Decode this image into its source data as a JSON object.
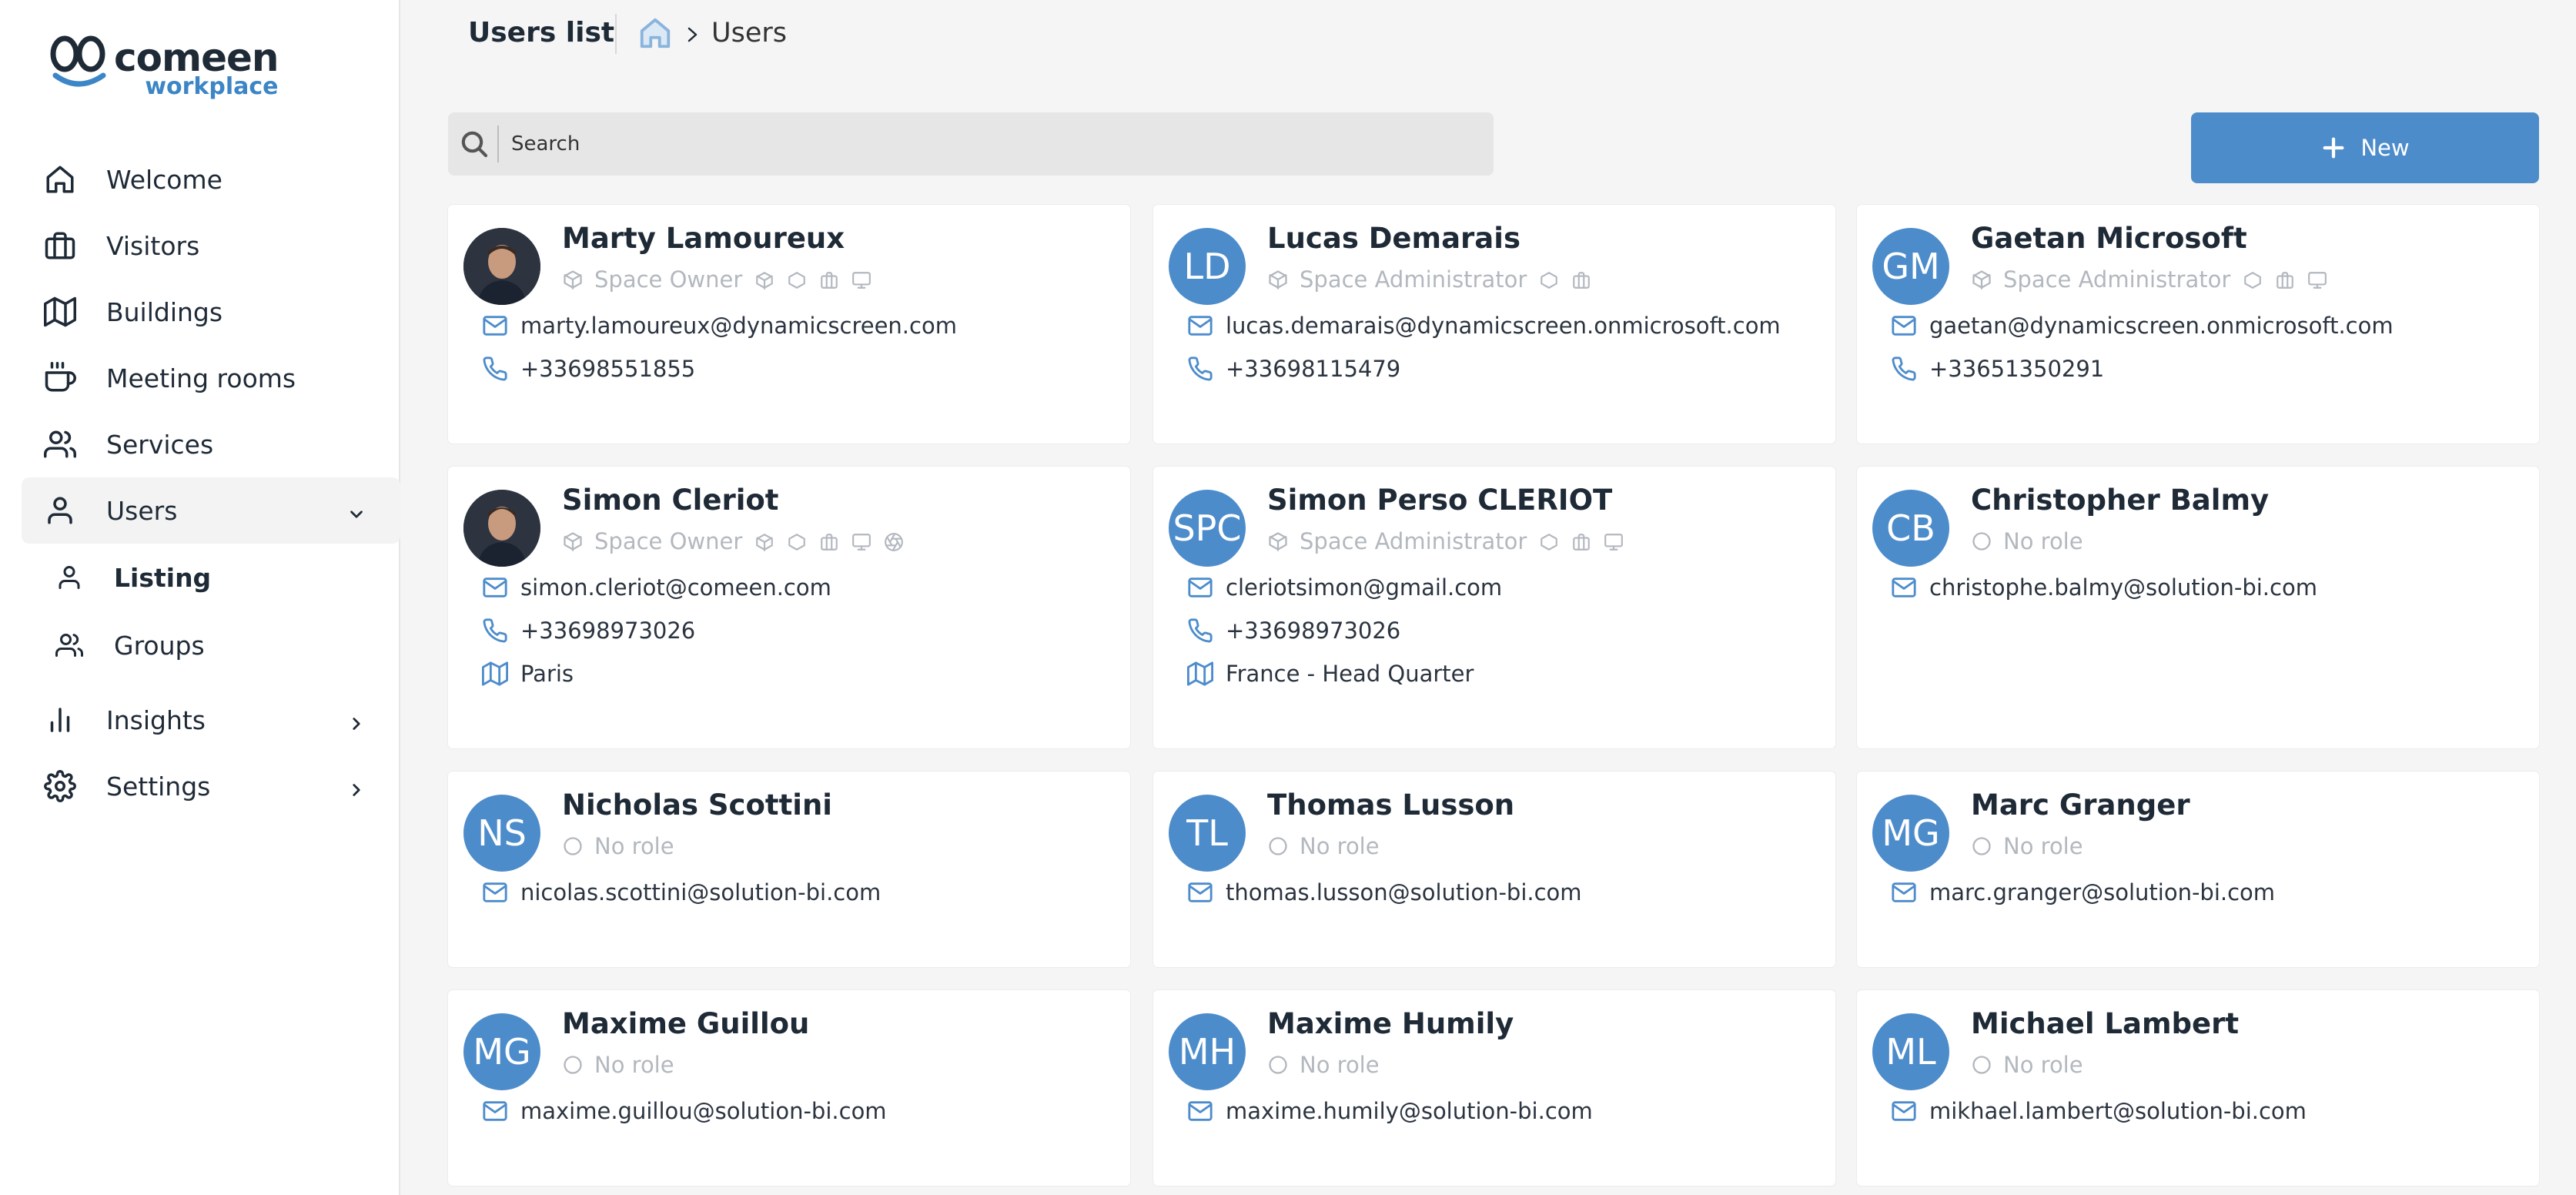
{
  "app": {
    "logo_primary": "comeen",
    "logo_secondary": "workplace"
  },
  "sidebar": {
    "items": [
      {
        "label": "Welcome",
        "icon": "home-icon"
      },
      {
        "label": "Visitors",
        "icon": "briefcase-icon"
      },
      {
        "label": "Buildings",
        "icon": "map-icon"
      },
      {
        "label": "Meeting rooms",
        "icon": "coffee-cup-icon"
      },
      {
        "label": "Services",
        "icon": "users-icon"
      },
      {
        "label": "Users",
        "icon": "user-icon",
        "expanded": true
      },
      {
        "label": "Insights",
        "icon": "bar-chart-icon"
      },
      {
        "label": "Settings",
        "icon": "gear-icon"
      }
    ],
    "sub_items": [
      {
        "label": "Listing",
        "icon": "user-icon",
        "current": true
      },
      {
        "label": "Groups",
        "icon": "users-icon"
      }
    ]
  },
  "header": {
    "title": "Users list",
    "breadcrumb": "Users"
  },
  "search": {
    "placeholder": "Search"
  },
  "new_button": {
    "label": "New"
  },
  "colors": {
    "accent": "#4d8ccb",
    "muted": "#b3b8bf",
    "text": "#1f2a37"
  },
  "users": [
    {
      "name": "Marty Lamoureux",
      "initials": "",
      "photo": true,
      "role": "Space Owner",
      "role_icons": [
        "cube-icon",
        "hexagon-icon",
        "briefcase-icon",
        "monitor-icon"
      ],
      "email": "marty.lamoureux@dynamicscreen.com",
      "phone": "+33698551855",
      "location": ""
    },
    {
      "name": "Lucas Demarais",
      "initials": "LD",
      "photo": false,
      "role": "Space Administrator",
      "role_icons": [
        "hexagon-icon",
        "briefcase-icon"
      ],
      "email": "lucas.demarais@dynamicscreen.onmicrosoft.com",
      "phone": "+33698115479",
      "location": ""
    },
    {
      "name": "Gaetan Microsoft",
      "initials": "GM",
      "photo": false,
      "role": "Space Administrator",
      "role_icons": [
        "hexagon-icon",
        "briefcase-icon",
        "monitor-icon"
      ],
      "email": "gaetan@dynamicscreen.onmicrosoft.com",
      "phone": "+33651350291",
      "location": ""
    },
    {
      "name": "Simon Cleriot",
      "initials": "",
      "photo": true,
      "role": "Space Owner",
      "role_icons": [
        "cube-icon",
        "hexagon-icon",
        "briefcase-icon",
        "monitor-icon",
        "aperture-icon"
      ],
      "email": "simon.cleriot@comeen.com",
      "phone": "+33698973026",
      "location": "Paris"
    },
    {
      "name": "Simon Perso CLERIOT",
      "initials": "SPC",
      "photo": false,
      "role": "Space Administrator",
      "role_icons": [
        "hexagon-icon",
        "briefcase-icon",
        "monitor-icon"
      ],
      "email": "cleriotsimon@gmail.com",
      "phone": "+33698973026",
      "location": "France - Head Quarter"
    },
    {
      "name": "Christopher Balmy",
      "initials": "CB",
      "photo": false,
      "role": "No role",
      "role_icons": [],
      "email": "christophe.balmy@solution-bi.com",
      "phone": "",
      "location": ""
    },
    {
      "name": "Nicholas Scottini",
      "initials": "NS",
      "photo": false,
      "role": "No role",
      "role_icons": [],
      "email": "nicolas.scottini@solution-bi.com",
      "phone": "",
      "location": ""
    },
    {
      "name": "Thomas Lusson",
      "initials": "TL",
      "photo": false,
      "role": "No role",
      "role_icons": [],
      "email": "thomas.lusson@solution-bi.com",
      "phone": "",
      "location": ""
    },
    {
      "name": "Marc Granger",
      "initials": "MG",
      "photo": false,
      "role": "No role",
      "role_icons": [],
      "email": "marc.granger@solution-bi.com",
      "phone": "",
      "location": ""
    },
    {
      "name": "Maxime Guillou",
      "initials": "MG",
      "photo": false,
      "role": "No role",
      "role_icons": [],
      "email": "maxime.guillou@solution-bi.com",
      "phone": "",
      "location": ""
    },
    {
      "name": "Maxime Humily",
      "initials": "MH",
      "photo": false,
      "role": "No role",
      "role_icons": [],
      "email": "maxime.humily@solution-bi.com",
      "phone": "",
      "location": ""
    },
    {
      "name": "Michael Lambert",
      "initials": "ML",
      "photo": false,
      "role": "No role",
      "role_icons": [],
      "email": "mikhael.lambert@solution-bi.com",
      "phone": "",
      "location": ""
    }
  ]
}
